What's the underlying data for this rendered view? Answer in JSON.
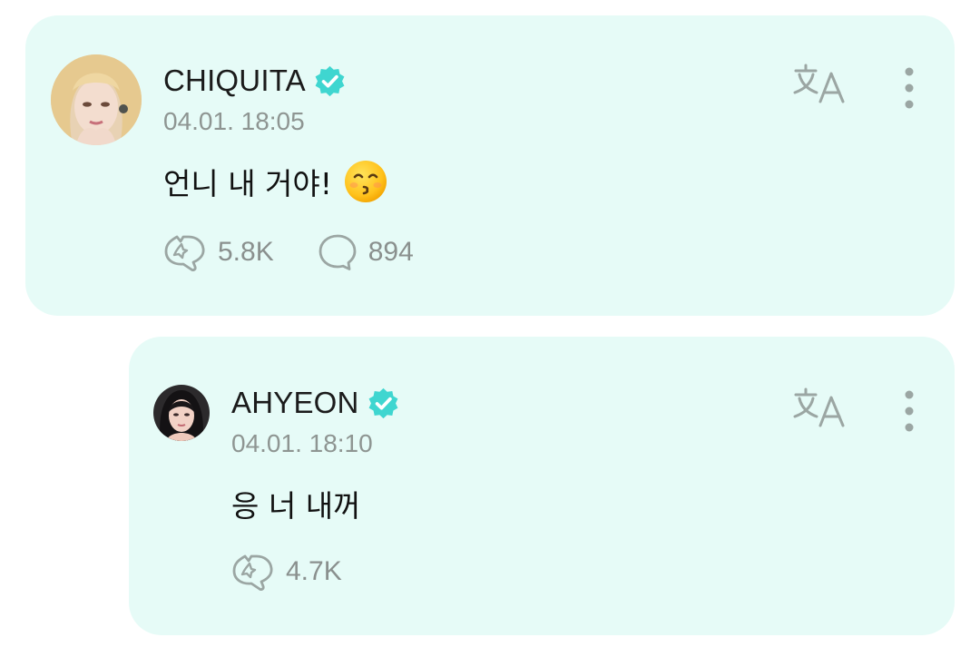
{
  "theme": {
    "card_background": "#e6fbf7",
    "verified_color": "#3fd6d0",
    "icon_color": "#9ba6a3",
    "meta_text_color": "#8e9592"
  },
  "posts": [
    {
      "author": "CHIQUITA",
      "timestamp": "04.01. 18:05",
      "body": "언니 내 거야!",
      "emoji": "kissing-face-with-smiling-eyes",
      "likes": "5.8K",
      "comments": "894"
    },
    {
      "author": "AHYEON",
      "timestamp": "04.01. 18:10",
      "body": "응 너 내꺼",
      "likes": "4.7K"
    }
  ],
  "icons": {
    "verified": "verified-badge-icon",
    "translate": "translate-icon",
    "more": "more-vertical-icon",
    "like": "like-icon",
    "comment": "comment-icon"
  }
}
